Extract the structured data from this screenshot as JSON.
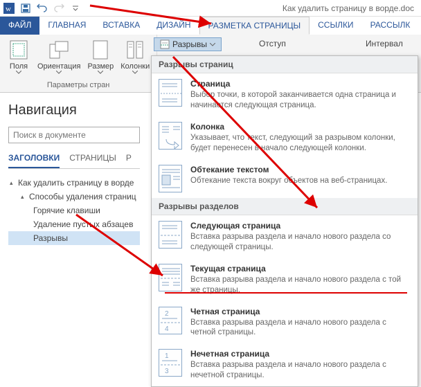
{
  "title": "Как удалить страницу в ворде.doc",
  "tabs": {
    "file": "ФАЙЛ",
    "home": "ГЛАВНАЯ",
    "insert": "ВСТАВКА",
    "design": "ДИЗАЙН",
    "layout": "РАЗМЕТКА СТРАНИЦЫ",
    "references": "ССЫЛКИ",
    "mailings": "РАССЫЛК"
  },
  "ribbon": {
    "margins": "Поля",
    "orientation": "Ориентация",
    "size": "Размер",
    "columns": "Колонки",
    "group_label": "Параметры стран",
    "breaks": "Разрывы",
    "indent": "Отступ",
    "interval": "Интервал"
  },
  "nav": {
    "title": "Навигация",
    "search_placeholder": "Поиск в документе",
    "tab_headings": "ЗАГОЛОВКИ",
    "tab_pages": "СТРАНИЦЫ",
    "tab_results": "Р",
    "tree": {
      "root": "Как удалить страницу в ворде",
      "c1": "Способы удаления страниц",
      "c1a": "Горячие клавиши",
      "c1b": "Удаление пустых абзацев",
      "c1c": "Разрывы"
    }
  },
  "dropdown": {
    "section1": "Разрывы страниц",
    "section2": "Разрывы разделов",
    "items": {
      "page": {
        "t": "Страница",
        "d": "Выбор точки, в которой заканчивается одна страница и начинается следующая страница."
      },
      "column": {
        "t": "Колонка",
        "d": "Указывает, что текст, следующий за разрывом колонки, будет перенесен в начало следующей колонки."
      },
      "textwrap": {
        "t": "Обтекание текстом",
        "d": "Обтекание текста вокруг объектов на веб-страницах."
      },
      "nextpage": {
        "t": "Следующая страница",
        "d": "Вставка разрыва раздела и начало нового раздела со следующей страницы."
      },
      "continuous": {
        "t": "Текущая страница",
        "d": "Вставка разрыва раздела и начало нового раздела с той же страницы."
      },
      "evenpage": {
        "t": "Четная страница",
        "d": "Вставка разрыва раздела и начало нового раздела с четной страницы."
      },
      "oddpage": {
        "t": "Нечетная страница",
        "d": "Вставка разрыва раздела и начало нового раздела с нечетной страницы."
      }
    }
  }
}
